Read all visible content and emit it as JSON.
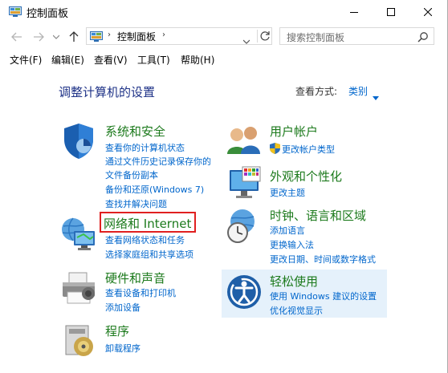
{
  "window": {
    "title": "控制面板"
  },
  "nav": {
    "address_text": "控制面板",
    "search_placeholder": "搜索控制面板"
  },
  "menu": [
    "文件(F)",
    "编辑(E)",
    "查看(V)",
    "工具(T)",
    "帮助(H)"
  ],
  "content": {
    "heading": "调整计算机的设置",
    "view_by_label": "查看方式:",
    "view_by_value": "类别"
  },
  "categories": {
    "system": {
      "title": "系统和安全",
      "links": [
        "查看你的计算机状态",
        "通过文件历史记录保存你的",
        "文件备份副本",
        "备份和还原(Windows 7)",
        "查找并解决问题"
      ]
    },
    "network": {
      "title": "网络和 Internet",
      "links": [
        "查看网络状态和任务",
        "选择家庭组和共享选项"
      ]
    },
    "hardware": {
      "title": "硬件和声音",
      "links": [
        "查看设备和打印机",
        "添加设备"
      ]
    },
    "programs": {
      "title": "程序",
      "links": [
        "卸载程序"
      ]
    },
    "accounts": {
      "title": "用户帐户",
      "links": [
        "更改帐户类型"
      ]
    },
    "appearance": {
      "title": "外观和个性化",
      "links": [
        "更改主题"
      ]
    },
    "clock": {
      "title": "时钟、语言和区域",
      "links": [
        "添加语言",
        "更换输入法",
        "更改日期、时间或数字格式"
      ]
    },
    "ease": {
      "title": "轻松使用",
      "links": [
        "使用 Windows 建议的设置",
        "优化视觉显示"
      ]
    }
  },
  "colors": {
    "category_title": "#1c7a1c",
    "link": "#0066cc",
    "heading": "#1e3287",
    "highlight_border": "#e02020",
    "hover_panel": "#e5f1fb"
  }
}
